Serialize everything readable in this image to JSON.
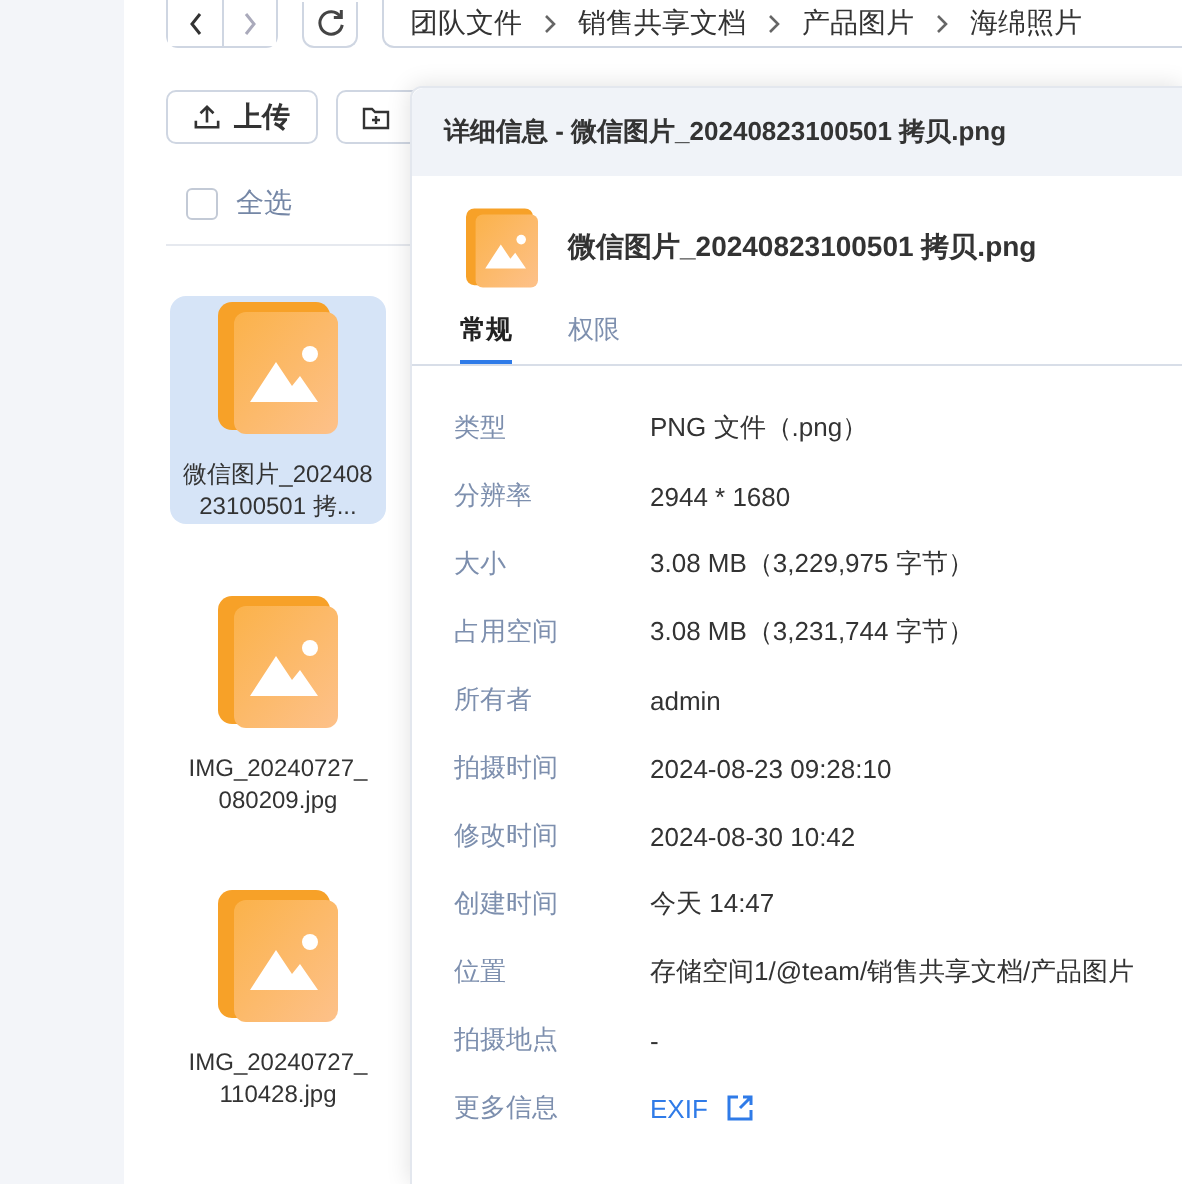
{
  "nav": {
    "breadcrumb": [
      "团队文件",
      "销售共享文档",
      "产品图片",
      "海绵照片"
    ]
  },
  "toolbar": {
    "upload": "上传"
  },
  "select_all": {
    "label": "全选",
    "checked": false
  },
  "files": [
    {
      "name": "微信图片_20240823100501 拷...",
      "selected": true
    },
    {
      "name": "IMG_20240727_080209.jpg",
      "selected": false
    },
    {
      "name": "IMG_20240727_110428.jpg",
      "selected": false
    }
  ],
  "dialog": {
    "title": "详细信息 - 微信图片_20240823100501 拷贝.png",
    "file_name": "微信图片_20240823100501 拷贝.png",
    "tabs": [
      {
        "label": "常规",
        "selected": true
      },
      {
        "label": "权限",
        "selected": false
      }
    ],
    "properties": [
      {
        "label": "类型",
        "value": "PNG 文件（.png）",
        "kind": "text"
      },
      {
        "label": "分辨率",
        "value": "2944 * 1680",
        "kind": "text"
      },
      {
        "label": "大小",
        "value": "3.08 MB（3,229,975 字节）",
        "kind": "text"
      },
      {
        "label": "占用空间",
        "value": "3.08 MB（3,231,744 字节）",
        "kind": "text"
      },
      {
        "label": "所有者",
        "value": "admin",
        "kind": "text"
      },
      {
        "label": "拍摄时间",
        "value": "2024-08-23 09:28:10",
        "kind": "text"
      },
      {
        "label": "修改时间",
        "value": "2024-08-30 10:42",
        "kind": "text"
      },
      {
        "label": "创建时间",
        "value": "今天 14:47",
        "kind": "text"
      },
      {
        "label": "位置",
        "value": "存储空间1/@team/销售共享文档/产品图片",
        "kind": "text"
      },
      {
        "label": "拍摄地点",
        "value": "-",
        "kind": "text"
      },
      {
        "label": "更多信息",
        "value": "EXIF",
        "kind": "link"
      }
    ]
  }
}
